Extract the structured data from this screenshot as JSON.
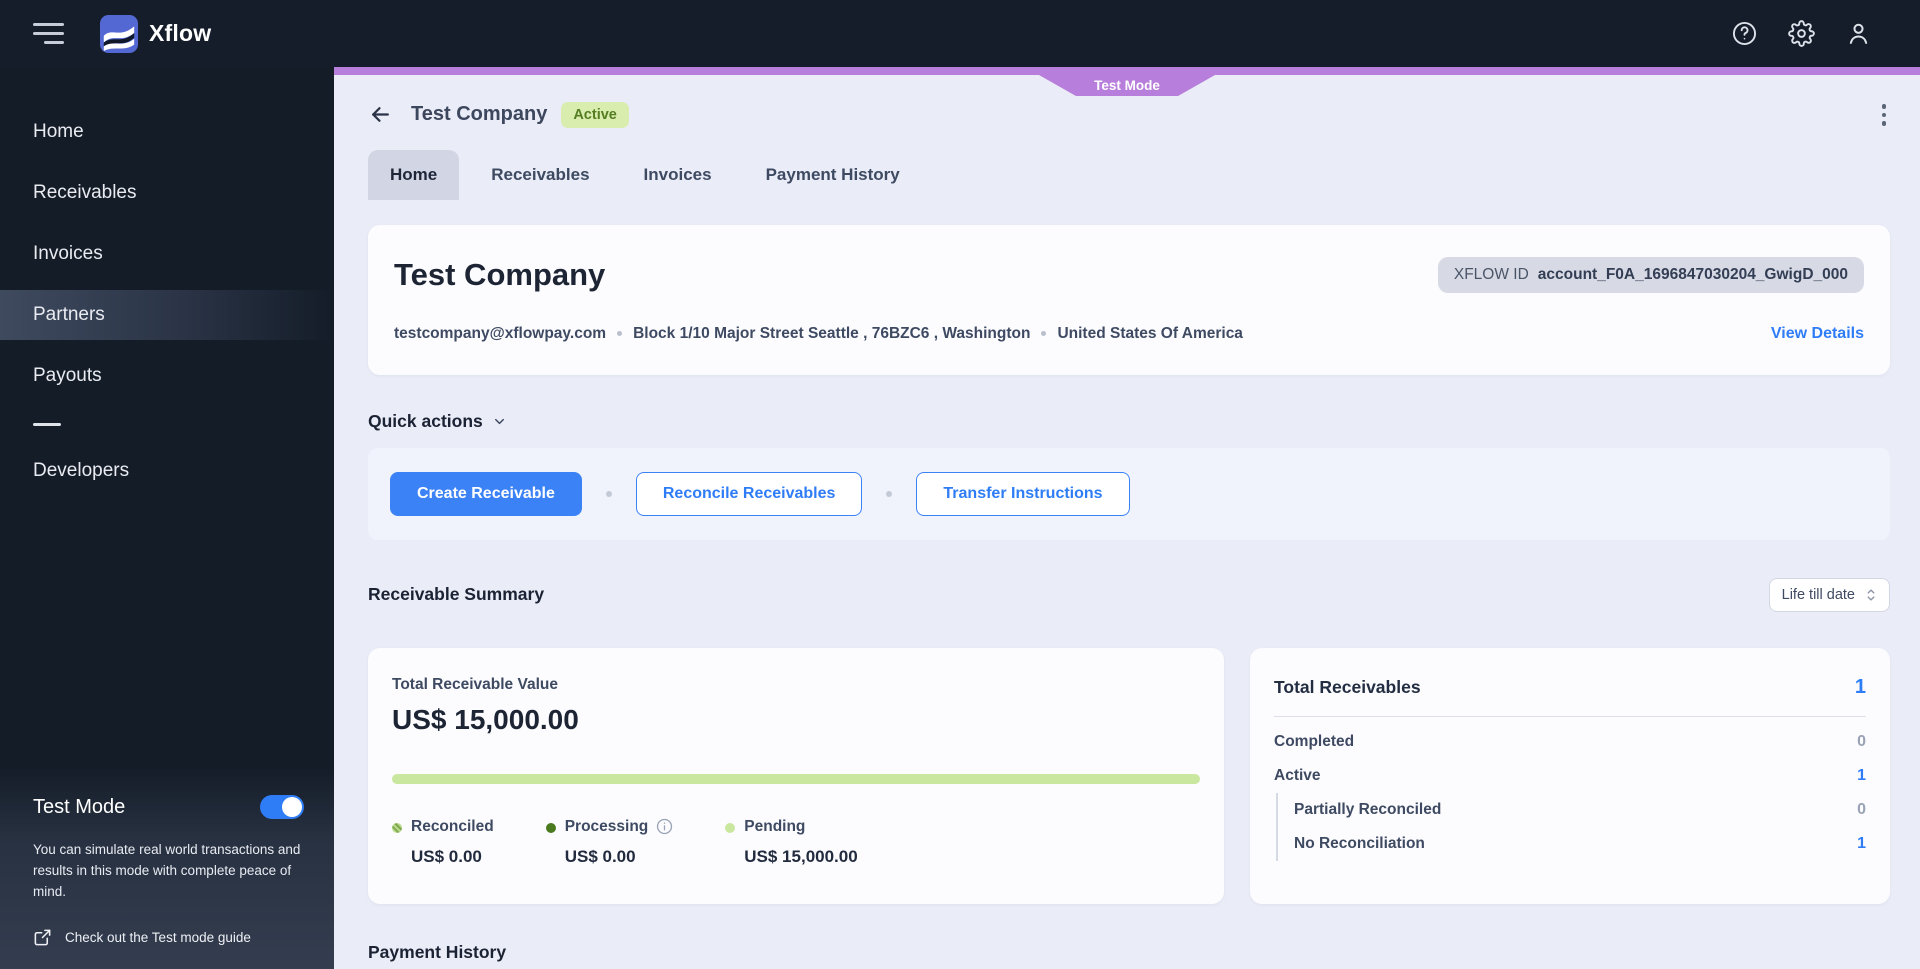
{
  "colors": {
    "accent_blue": "#2f7df6",
    "brand_indigo": "#5468d4",
    "test_mode_purple": "#b77edb",
    "active_badge_bg": "#d9edae",
    "active_badge_text": "#557d22",
    "progress_green": "#c9e79e",
    "processing_green": "#4a7a1e"
  },
  "topbar": {
    "brand": "Xflow"
  },
  "sidebar": {
    "items": [
      {
        "label": "Home",
        "active": false
      },
      {
        "label": "Receivables",
        "active": false
      },
      {
        "label": "Invoices",
        "active": false
      },
      {
        "label": "Partners",
        "active": true
      },
      {
        "label": "Payouts",
        "active": false
      },
      {
        "label": "Developers",
        "active": false
      }
    ],
    "test_mode": {
      "title": "Test Mode",
      "toggle_on": true,
      "description": "You can simulate real world transactions and results in this mode with complete peace of mind.",
      "guide_link": "Check out the Test mode guide"
    }
  },
  "ribbon": {
    "label": "Test Mode"
  },
  "header": {
    "title": "Test Company",
    "status_badge": "Active",
    "tabs": [
      {
        "label": "Home",
        "active": true
      },
      {
        "label": "Receivables",
        "active": false
      },
      {
        "label": "Invoices",
        "active": false
      },
      {
        "label": "Payment History",
        "active": false
      }
    ]
  },
  "company_card": {
    "name": "Test Company",
    "xflow_id_label": "XFLOW ID",
    "xflow_id_value": "account_F0A_1696847030204_GwigD_000",
    "email": "testcompany@xflowpay.com",
    "address": "Block 1/10 Major Street Seattle , 76BZC6 , Washington",
    "country": "United States Of America",
    "view_details": "View Details"
  },
  "quick_actions": {
    "title": "Quick actions",
    "buttons": [
      {
        "label": "Create Receivable",
        "style": "primary"
      },
      {
        "label": "Reconcile Receivables",
        "style": "outline"
      },
      {
        "label": "Transfer Instructions",
        "style": "outline"
      }
    ]
  },
  "receivable_summary": {
    "title": "Receivable Summary",
    "filter_value": "Life till date",
    "total_value_card": {
      "label": "Total Receivable Value",
      "value": "US$ 15,000.00",
      "legend": [
        {
          "label": "Reconciled",
          "value": "US$ 0.00"
        },
        {
          "label": "Processing",
          "value": "US$ 0.00",
          "info": true
        },
        {
          "label": "Pending",
          "value": "US$ 15,000.00"
        }
      ]
    },
    "totals_card": {
      "title": "Total Receivables",
      "total": "1",
      "rows": [
        {
          "label": "Completed",
          "value": "0",
          "muted": true,
          "indent": false
        },
        {
          "label": "Active",
          "value": "1",
          "muted": false,
          "indent": false
        },
        {
          "label": "Partially Reconciled",
          "value": "0",
          "muted": true,
          "indent": true
        },
        {
          "label": "No Reconciliation",
          "value": "1",
          "muted": false,
          "indent": true
        }
      ]
    }
  },
  "next_section": {
    "title": "Payment History"
  }
}
